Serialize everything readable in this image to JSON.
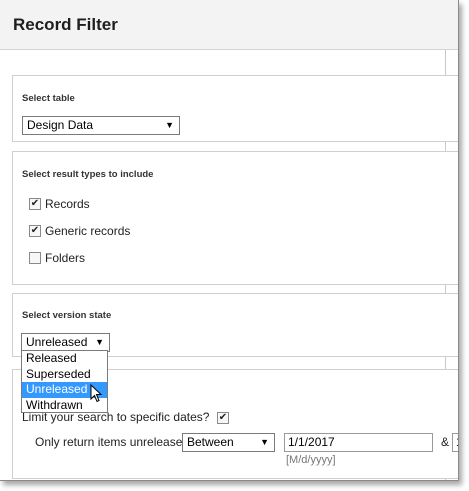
{
  "title": "Record Filter",
  "table_section": {
    "label": "Select table",
    "selected": "Design Data"
  },
  "result_types": {
    "label": "Select result types to include",
    "items": [
      {
        "label": "Records",
        "checked": true
      },
      {
        "label": "Generic records",
        "checked": true
      },
      {
        "label": "Folders",
        "checked": false
      }
    ]
  },
  "version_state": {
    "label": "Select version state",
    "selected": "Unreleased",
    "options": [
      "Released",
      "Superseded",
      "Unreleased",
      "Withdrawn"
    ],
    "highlighted": "Unreleased"
  },
  "date_section": {
    "limit_label": "Limit your search to specific dates?",
    "limit_checked": true,
    "return_label": "Only return items unreleased",
    "operator": "Between",
    "start_date": "1/1/2017",
    "date_hint": "[M/d/yyyy]",
    "and_symbol": "&",
    "end_date_partial": "1"
  },
  "glyphs": {
    "check": "✔",
    "arrow": "▼"
  }
}
